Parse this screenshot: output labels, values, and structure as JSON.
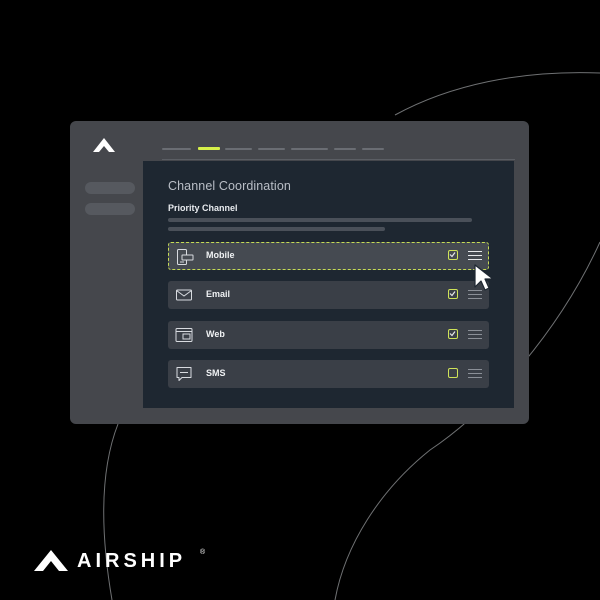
{
  "content": {
    "title": "Channel Coordination",
    "section_label": "Priority Channel"
  },
  "channels": [
    {
      "label": "Mobile",
      "icon": "mobile-icon",
      "checked": true,
      "active": true
    },
    {
      "label": "Email",
      "icon": "email-icon",
      "checked": true,
      "active": false
    },
    {
      "label": "Web",
      "icon": "web-icon",
      "checked": true,
      "active": false
    },
    {
      "label": "SMS",
      "icon": "sms-icon",
      "checked": false,
      "active": false
    }
  ],
  "tabs": {
    "count": 7,
    "active_index": 1
  },
  "brand": {
    "name": "AIRSHIP",
    "registered": "®"
  },
  "colors": {
    "background": "#000000",
    "window": "#45474c",
    "content": "#1e2731",
    "accent": "#d6f04a"
  }
}
